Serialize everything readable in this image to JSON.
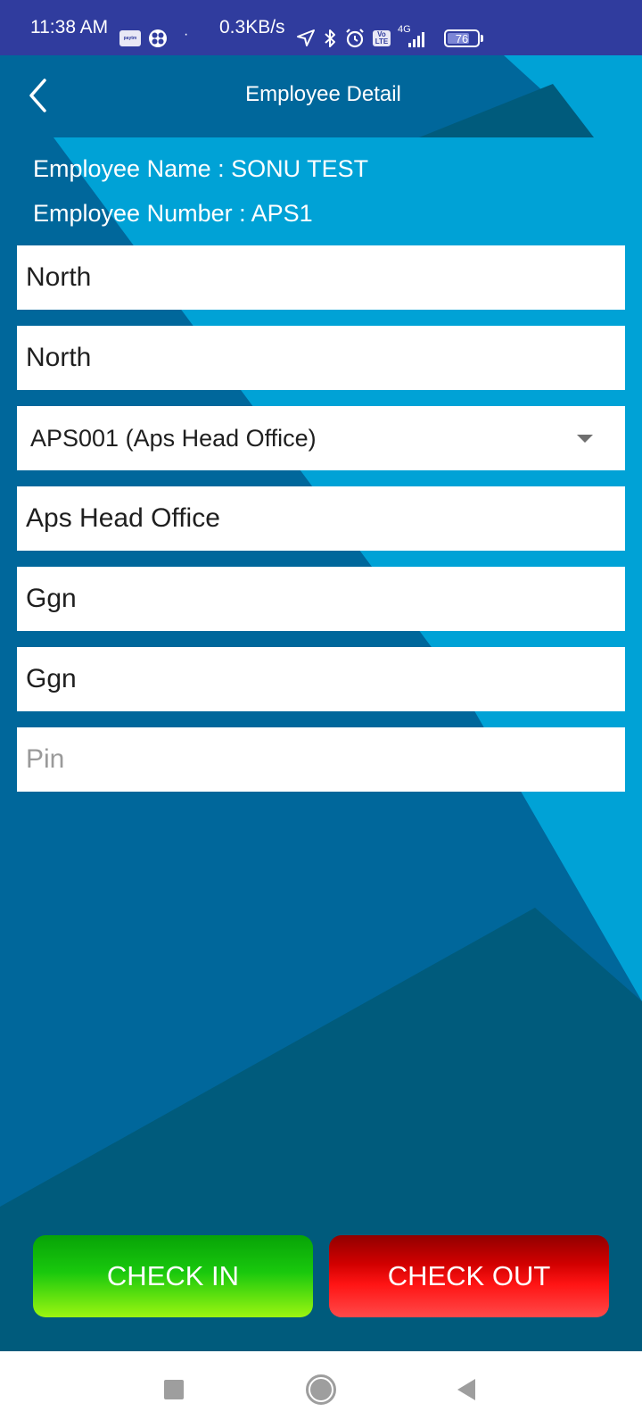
{
  "status_bar": {
    "time": "11:38 AM",
    "paytm_label": "Paytm",
    "separator": "·",
    "network_speed": "0.3KB/s",
    "volte_top": "Vo",
    "volte_bottom": "LTE",
    "network_type": "4G",
    "battery_percent": "76",
    "battery_level": 0.76
  },
  "header": {
    "title": "Employee Detail"
  },
  "employee": {
    "name_label": "Employee Name :",
    "name_value": "SONU TEST",
    "number_label": "Employee Number :",
    "number_value": "APS1"
  },
  "form": {
    "fields": [
      {
        "value": "North",
        "placeholder": ""
      },
      {
        "value": "North",
        "placeholder": ""
      },
      {
        "value": "APS001 (Aps Head Office)",
        "type": "dropdown"
      },
      {
        "value": "Aps Head Office",
        "placeholder": ""
      },
      {
        "value": "Ggn",
        "placeholder": ""
      },
      {
        "value": "Ggn",
        "placeholder": ""
      },
      {
        "value": "",
        "placeholder": "Pin"
      }
    ]
  },
  "actions": {
    "check_in_label": "CHECK IN",
    "check_out_label": "CHECK OUT"
  },
  "colors": {
    "status_bar": "#303c9e",
    "background_primary": "#00679b",
    "background_light": "#00a2d6",
    "background_dark": "#005b7c",
    "check_in": "#19c80d",
    "check_out": "#ff1414"
  }
}
